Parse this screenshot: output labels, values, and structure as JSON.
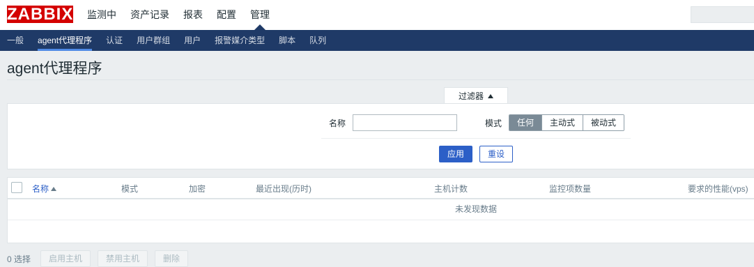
{
  "header": {
    "logo": "ZABBIX",
    "main_nav": [
      {
        "label": "监测中"
      },
      {
        "label": "资产记录"
      },
      {
        "label": "报表"
      },
      {
        "label": "配置"
      },
      {
        "label": "管理",
        "active": true
      }
    ]
  },
  "sub_nav": [
    {
      "label": "一般"
    },
    {
      "label": "agent代理程序",
      "active": true
    },
    {
      "label": "认证"
    },
    {
      "label": "用户群组"
    },
    {
      "label": "用户"
    },
    {
      "label": "报警媒介类型"
    },
    {
      "label": "脚本"
    },
    {
      "label": "队列"
    }
  ],
  "page": {
    "title": "agent代理程序"
  },
  "filter": {
    "tab_label": "过滤器",
    "name_label": "名称",
    "name_value": "",
    "mode_label": "模式",
    "mode_options": [
      "任何",
      "主动式",
      "被动式"
    ],
    "mode_selected": "任何",
    "apply_label": "应用",
    "reset_label": "重设"
  },
  "table": {
    "columns": [
      "名称",
      "模式",
      "加密",
      "最近出现(历时)",
      "主机计数",
      "监控项数量",
      "要求的性能(vps)"
    ],
    "sorted_column": "名称",
    "empty_text": "未发现数据"
  },
  "footer": {
    "selected_count": "0 选择",
    "actions": [
      "启用主机",
      "禁用主机",
      "删除"
    ]
  },
  "colors": {
    "brand_red": "#d40000",
    "nav_dark": "#1f3a67",
    "accent_blue": "#2c5fc7"
  }
}
